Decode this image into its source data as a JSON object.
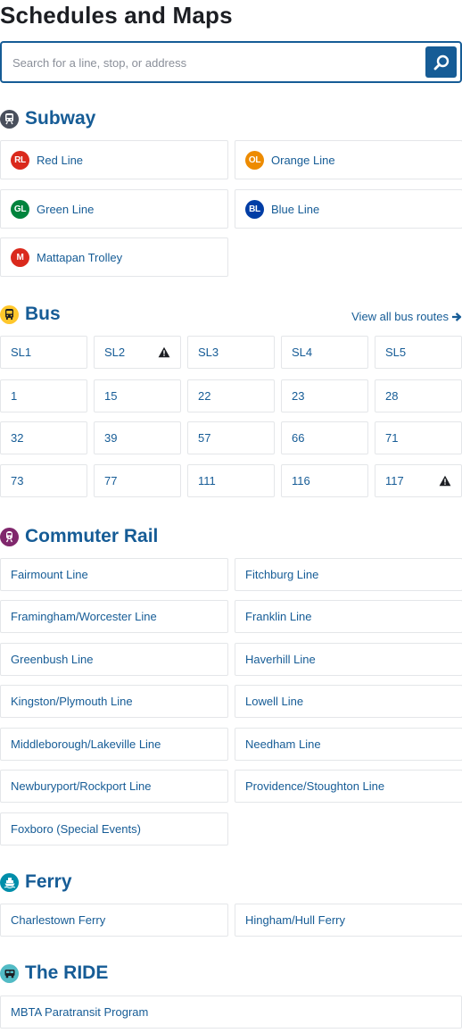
{
  "page_title": "Schedules and Maps",
  "search": {
    "placeholder": "Search for a line, stop, or address",
    "icon": "search-icon"
  },
  "sections": {
    "subway": {
      "title": "Subway",
      "icon": "subway-icon",
      "icon_color": "#494f5c",
      "lines": [
        {
          "badge": "RL",
          "label": "Red Line",
          "color": "#da291c"
        },
        {
          "badge": "OL",
          "label": "Orange Line",
          "color": "#ed8b00"
        },
        {
          "badge": "GL",
          "label": "Green Line",
          "color": "#00843d"
        },
        {
          "badge": "BL",
          "label": "Blue Line",
          "color": "#003da5"
        },
        {
          "badge": "M",
          "label": "Mattapan Trolley",
          "color": "#da291c"
        }
      ]
    },
    "bus": {
      "title": "Bus",
      "icon": "bus-icon",
      "icon_color": "#ffc72c",
      "view_all": "View all bus routes",
      "routes": [
        {
          "label": "SL1",
          "alert": false
        },
        {
          "label": "SL2",
          "alert": true
        },
        {
          "label": "SL3",
          "alert": false
        },
        {
          "label": "SL4",
          "alert": false
        },
        {
          "label": "SL5",
          "alert": false
        },
        {
          "label": "1",
          "alert": false
        },
        {
          "label": "15",
          "alert": false
        },
        {
          "label": "22",
          "alert": false
        },
        {
          "label": "23",
          "alert": false
        },
        {
          "label": "28",
          "alert": false
        },
        {
          "label": "32",
          "alert": false
        },
        {
          "label": "39",
          "alert": false
        },
        {
          "label": "57",
          "alert": false
        },
        {
          "label": "66",
          "alert": false
        },
        {
          "label": "71",
          "alert": false
        },
        {
          "label": "73",
          "alert": false
        },
        {
          "label": "77",
          "alert": false
        },
        {
          "label": "111",
          "alert": false
        },
        {
          "label": "116",
          "alert": false
        },
        {
          "label": "117",
          "alert": true
        }
      ]
    },
    "commuter_rail": {
      "title": "Commuter Rail",
      "icon": "commuter-rail-icon",
      "icon_color": "#80276c",
      "lines": [
        "Fairmount Line",
        "Fitchburg Line",
        "Framingham/Worcester Line",
        "Franklin Line",
        "Greenbush Line",
        "Haverhill Line",
        "Kingston/Plymouth Line",
        "Lowell Line",
        "Middleborough/Lakeville Line",
        "Needham Line",
        "Newburyport/Rockport Line",
        "Providence/Stoughton Line",
        "Foxboro (Special Events)"
      ]
    },
    "ferry": {
      "title": "Ferry",
      "icon": "ferry-icon",
      "icon_color": "#008eaa",
      "lines": [
        "Charlestown Ferry",
        "Hingham/Hull Ferry"
      ]
    },
    "the_ride": {
      "title": "The RIDE",
      "icon": "the-ride-icon",
      "icon_color": "#52bbc5",
      "lines": [
        "MBTA Paratransit Program"
      ]
    }
  },
  "colors": {
    "brand": "#165c96",
    "card_border": "#e4e6e9",
    "title": "#1c1e23"
  }
}
